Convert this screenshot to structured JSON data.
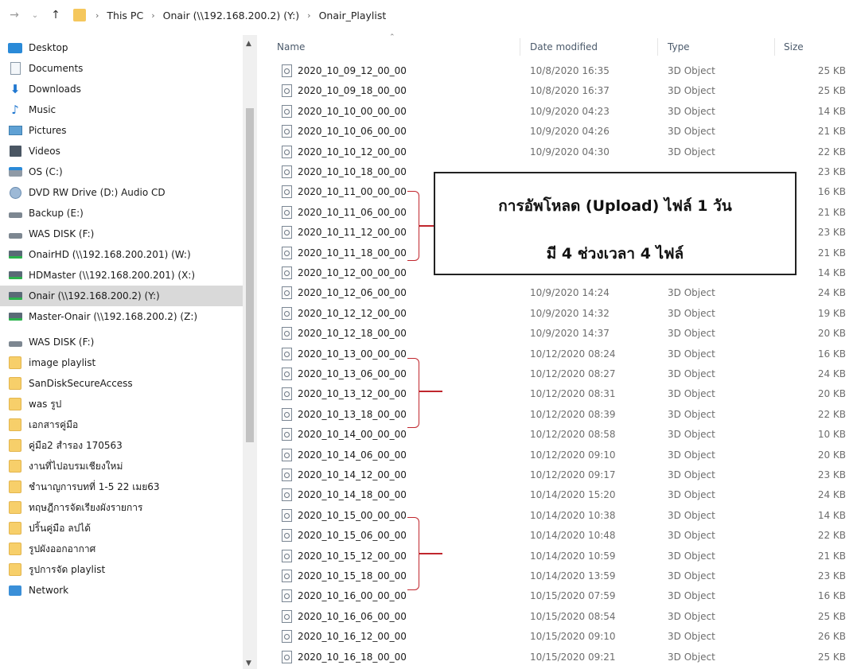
{
  "address_bar": {
    "crumbs": [
      "This PC",
      "Onair (\\\\192.168.200.2) (Y:)",
      "Onair_Playlist"
    ]
  },
  "nav_pane": {
    "items": [
      {
        "label": "Desktop",
        "icon": "desktop-icon",
        "selected": false
      },
      {
        "label": "Documents",
        "icon": "documents-icon",
        "selected": false
      },
      {
        "label": "Downloads",
        "icon": "downloads-icon",
        "selected": false
      },
      {
        "label": "Music",
        "icon": "music-icon",
        "selected": false
      },
      {
        "label": "Pictures",
        "icon": "pictures-icon",
        "selected": false
      },
      {
        "label": "Videos",
        "icon": "videos-icon",
        "selected": false
      },
      {
        "label": "OS (C:)",
        "icon": "os-drive-icon",
        "selected": false
      },
      {
        "label": "DVD RW Drive (D:) Audio CD",
        "icon": "dvd-drive-icon",
        "selected": false
      },
      {
        "label": "Backup (E:)",
        "icon": "drive-icon",
        "selected": false
      },
      {
        "label": "WAS DISK (F:)",
        "icon": "drive-icon",
        "selected": false
      },
      {
        "label": "OnairHD (\\\\192.168.200.201) (W:)",
        "icon": "network-drive-icon",
        "selected": false
      },
      {
        "label": "HDMaster (\\\\192.168.200.201) (X:)",
        "icon": "network-drive-icon",
        "selected": false
      },
      {
        "label": "Onair (\\\\192.168.200.2) (Y:)",
        "icon": "network-drive-icon",
        "selected": true
      },
      {
        "label": "Master-Onair (\\\\192.168.200.2) (Z:)",
        "icon": "network-drive-icon",
        "selected": false
      },
      {
        "label": "WAS DISK (F:)",
        "icon": "drive-icon",
        "selected": false
      },
      {
        "label": "image playlist",
        "icon": "folder-icon",
        "selected": false
      },
      {
        "label": "SanDiskSecureAccess",
        "icon": "folder-icon",
        "selected": false
      },
      {
        "label": "was รูป",
        "icon": "folder-icon",
        "selected": false
      },
      {
        "label": "เอกสารคู่มือ",
        "icon": "folder-icon",
        "selected": false
      },
      {
        "label": "คู่มือ2 สำรอง 170563",
        "icon": "folder-icon",
        "selected": false
      },
      {
        "label": "งานที่ไปอบรมเชียงใหม่",
        "icon": "folder-icon",
        "selected": false
      },
      {
        "label": "ชำนาญการบทที่ 1-5 22 เมย63",
        "icon": "folder-icon",
        "selected": false
      },
      {
        "label": "ทฤษฎีการจัดเรียงผังรายการ",
        "icon": "folder-icon",
        "selected": false
      },
      {
        "label": "ปริ้นคู่มือ ลปได้",
        "icon": "folder-icon",
        "selected": false
      },
      {
        "label": "รูปผังออกอากาศ",
        "icon": "folder-icon",
        "selected": false
      },
      {
        "label": "รูปการจัด playlist",
        "icon": "folder-icon",
        "selected": false
      },
      {
        "label": "Network",
        "icon": "network-icon",
        "selected": false
      }
    ]
  },
  "file_list": {
    "columns": {
      "name": "Name",
      "date": "Date modified",
      "type": "Type",
      "size": "Size"
    },
    "rows": [
      {
        "name": "2020_10_09_12_00_00",
        "date": "10/8/2020 16:35",
        "type": "3D Object",
        "size": "25 KB"
      },
      {
        "name": "2020_10_09_18_00_00",
        "date": "10/8/2020 16:37",
        "type": "3D Object",
        "size": "25 KB"
      },
      {
        "name": "2020_10_10_00_00_00",
        "date": "10/9/2020 04:23",
        "type": "3D Object",
        "size": "14 KB"
      },
      {
        "name": "2020_10_10_06_00_00",
        "date": "10/9/2020 04:26",
        "type": "3D Object",
        "size": "21 KB"
      },
      {
        "name": "2020_10_10_12_00_00",
        "date": "10/9/2020 04:30",
        "type": "3D Object",
        "size": "22 KB"
      },
      {
        "name": "2020_10_10_18_00_00",
        "date": "",
        "type": "",
        "size": "23 KB"
      },
      {
        "name": "2020_10_11_00_00_00",
        "date": "",
        "type": "",
        "size": "16 KB"
      },
      {
        "name": "2020_10_11_06_00_00",
        "date": "",
        "type": "",
        "size": "21 KB"
      },
      {
        "name": "2020_10_11_12_00_00",
        "date": "",
        "type": "",
        "size": "23 KB"
      },
      {
        "name": "2020_10_11_18_00_00",
        "date": "",
        "type": "",
        "size": "21 KB"
      },
      {
        "name": "2020_10_12_00_00_00",
        "date": "",
        "type": "",
        "size": "14 KB"
      },
      {
        "name": "2020_10_12_06_00_00",
        "date": "10/9/2020 14:24",
        "type": "3D Object",
        "size": "24 KB"
      },
      {
        "name": "2020_10_12_12_00_00",
        "date": "10/9/2020 14:32",
        "type": "3D Object",
        "size": "19 KB"
      },
      {
        "name": "2020_10_12_18_00_00",
        "date": "10/9/2020 14:37",
        "type": "3D Object",
        "size": "20 KB"
      },
      {
        "name": "2020_10_13_00_00_00",
        "date": "10/12/2020 08:24",
        "type": "3D Object",
        "size": "16 KB"
      },
      {
        "name": "2020_10_13_06_00_00",
        "date": "10/12/2020 08:27",
        "type": "3D Object",
        "size": "24 KB"
      },
      {
        "name": "2020_10_13_12_00_00",
        "date": "10/12/2020 08:31",
        "type": "3D Object",
        "size": "20 KB"
      },
      {
        "name": "2020_10_13_18_00_00",
        "date": "10/12/2020 08:39",
        "type": "3D Object",
        "size": "22 KB"
      },
      {
        "name": "2020_10_14_00_00_00",
        "date": "10/12/2020 08:58",
        "type": "3D Object",
        "size": "10 KB"
      },
      {
        "name": "2020_10_14_06_00_00",
        "date": "10/12/2020 09:10",
        "type": "3D Object",
        "size": "20 KB"
      },
      {
        "name": "2020_10_14_12_00_00",
        "date": "10/12/2020 09:17",
        "type": "3D Object",
        "size": "23 KB"
      },
      {
        "name": "2020_10_14_18_00_00",
        "date": "10/14/2020 15:20",
        "type": "3D Object",
        "size": "24 KB"
      },
      {
        "name": "2020_10_15_00_00_00",
        "date": "10/14/2020 10:38",
        "type": "3D Object",
        "size": "14 KB"
      },
      {
        "name": "2020_10_15_06_00_00",
        "date": "10/14/2020 10:48",
        "type": "3D Object",
        "size": "22 KB"
      },
      {
        "name": "2020_10_15_12_00_00",
        "date": "10/14/2020 10:59",
        "type": "3D Object",
        "size": "21 KB"
      },
      {
        "name": "2020_10_15_18_00_00",
        "date": "10/14/2020 13:59",
        "type": "3D Object",
        "size": "23 KB"
      },
      {
        "name": "2020_10_16_00_00_00",
        "date": "10/15/2020 07:59",
        "type": "3D Object",
        "size": "16 KB"
      },
      {
        "name": "2020_10_16_06_00_00",
        "date": "10/15/2020 08:54",
        "type": "3D Object",
        "size": "25 KB"
      },
      {
        "name": "2020_10_16_12_00_00",
        "date": "10/15/2020 09:10",
        "type": "3D Object",
        "size": "26 KB"
      },
      {
        "name": "2020_10_16_18_00_00",
        "date": "10/15/2020 09:21",
        "type": "3D Object",
        "size": "25 KB"
      }
    ]
  },
  "callout": {
    "line1": "การอัพโหลด (Upload) ไฟล์ 1 วัน",
    "line2": "มี 4 ช่วงเวลา 4 ไฟล์"
  },
  "colors": {
    "annotation_red": "#c0262d",
    "selection_gray": "#d9d9d9",
    "folder_yellow": "#f7cf6a"
  }
}
